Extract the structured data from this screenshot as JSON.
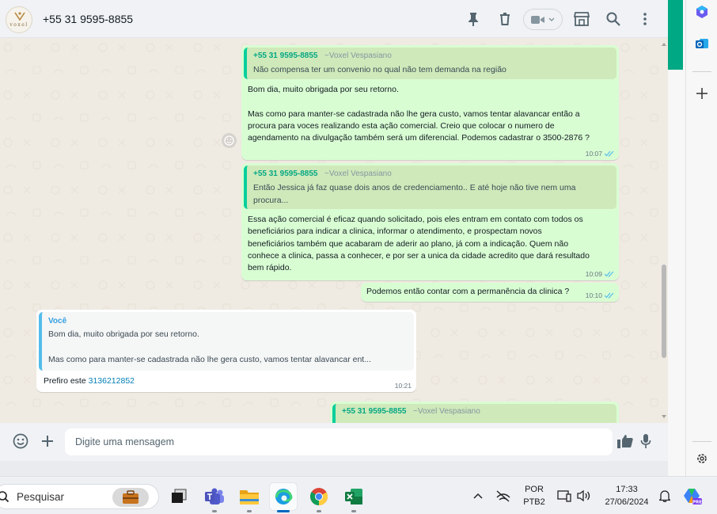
{
  "header": {
    "contact_name": "+55 31 9595-8855",
    "avatar_logo_text": "voxel",
    "icons": [
      "pin-icon",
      "delete-icon",
      "video-call-icon",
      "catalog-icon",
      "search-icon",
      "menu-icon"
    ]
  },
  "messages": {
    "m1": {
      "quote_author": "+55 31 9595-8855",
      "quote_pushname": "~Voxel Vespasiano",
      "quote_text": "Não compensa ter um convenio no qual não tem demanda na região",
      "lines": [
        "Bom dia, muito obrigada por seu retorno.",
        "",
        "Mas como para manter-se cadastrada não lhe gera custo, vamos tentar alavancar então a",
        "procura para voces realizando esta ação comercial. Creio que colocar o numero de",
        "agendamento na divulgação também será um diferencial. Podemos cadastrar o  3500-2876 ?"
      ],
      "time": "10:07"
    },
    "m2": {
      "quote_author": "+55 31 9595-8855",
      "quote_pushname": "~Voxel Vespasiano",
      "quote_lines": [
        "Então Jessica já faz quase dois anos de credenciamento.. E até hoje não tive nem uma",
        "procura..."
      ],
      "lines": [
        "Essa ação comercial é eficaz quando solicitado, pois eles entram em contato com todos os",
        "beneficiários para indicar a clinica, informar o atendimento, e prospectam novos",
        "beneficiários também que acabaram de aderir ao plano,  já com a indicação. Quem não",
        "conhece a clinica, passa a conhecer, e por ser a unica da cidade acredito que dará resultado",
        "bem rápido."
      ],
      "time": "10:09"
    },
    "m3": {
      "text": "Podemos então contar com a permanência da clinica ?",
      "time": "10:10"
    },
    "m4": {
      "quote_author": "Você",
      "quote_lines": [
        "Bom dia, muito obrigada por seu retorno.",
        "",
        "Mas como para manter-se cadastrada não lhe gera custo, vamos tentar alavancar ent..."
      ],
      "text_prefix": "Prefiro este ",
      "phone": "3136212852",
      "time": "10:21"
    },
    "m5": {
      "quote_author": "+55 31 9595-8855",
      "quote_pushname": "~Voxel Vespasiano"
    }
  },
  "composer": {
    "placeholder": "Digite uma mensagem"
  },
  "taskbar": {
    "search_label": "Pesquisar",
    "apps": [
      "briefcase-app",
      "task-view",
      "teams",
      "file-explorer",
      "edge",
      "chrome",
      "excel"
    ],
    "language_line1": "POR",
    "language_line2": "PTB2",
    "time": "17:33",
    "date": "27/06/2024"
  },
  "colors": {
    "wa_green": "#00a884",
    "bubble_out": "#d9fdd3",
    "quote_bar": "#06cf9c",
    "tick_blue": "#53bdeb",
    "link_blue": "#027eb5"
  }
}
